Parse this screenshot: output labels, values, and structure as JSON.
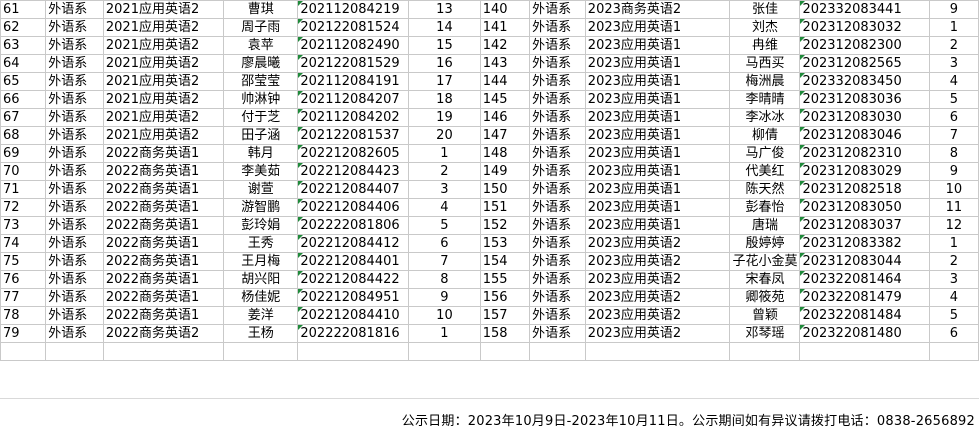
{
  "rows": [
    [
      "61",
      "外语系",
      "2021应用英语2",
      "曹琪",
      "202112084219",
      "13",
      "140",
      "外语系",
      "2023商务英语2",
      "张佳",
      "202332083441",
      "9"
    ],
    [
      "62",
      "外语系",
      "2021应用英语2",
      "周子雨",
      "202122081524",
      "14",
      "141",
      "外语系",
      "2023应用英语1",
      "刘杰",
      "202312083032",
      "1"
    ],
    [
      "63",
      "外语系",
      "2021应用英语2",
      "袁苹",
      "202112082490",
      "15",
      "142",
      "外语系",
      "2023应用英语1",
      "冉维",
      "202312082300",
      "2"
    ],
    [
      "64",
      "外语系",
      "2021应用英语2",
      "廖晨曦",
      "202122081529",
      "16",
      "143",
      "外语系",
      "2023应用英语1",
      "马西买",
      "202312082565",
      "3"
    ],
    [
      "65",
      "外语系",
      "2021应用英语2",
      "邵莹莹",
      "202112084191",
      "17",
      "144",
      "外语系",
      "2023应用英语1",
      "梅洲晨",
      "202332083450",
      "4"
    ],
    [
      "66",
      "外语系",
      "2021应用英语2",
      "帅淋钟",
      "202112084207",
      "18",
      "145",
      "外语系",
      "2023应用英语1",
      "李晴晴",
      "202312083036",
      "5"
    ],
    [
      "67",
      "外语系",
      "2021应用英语2",
      "付于芝",
      "202112084202",
      "19",
      "146",
      "外语系",
      "2023应用英语1",
      "李冰冰",
      "202312083030",
      "6"
    ],
    [
      "68",
      "外语系",
      "2021应用英语2",
      "田子涵",
      "202122081537",
      "20",
      "147",
      "外语系",
      "2023应用英语1",
      "柳倩",
      "202312083046",
      "7"
    ],
    [
      "69",
      "外语系",
      "2022商务英语1",
      "韩月",
      "202212082605",
      "1",
      "148",
      "外语系",
      "2023应用英语1",
      "马广俊",
      "202312082310",
      "8"
    ],
    [
      "70",
      "外语系",
      "2022商务英语1",
      "李美茹",
      "202212084423",
      "2",
      "149",
      "外语系",
      "2023应用英语1",
      "代美红",
      "202312083029",
      "9"
    ],
    [
      "71",
      "外语系",
      "2022商务英语1",
      "谢萱",
      "202212084407",
      "3",
      "150",
      "外语系",
      "2023应用英语1",
      "陈天然",
      "202312082518",
      "10"
    ],
    [
      "72",
      "外语系",
      "2022商务英语1",
      "游智鹏",
      "202212084406",
      "4",
      "151",
      "外语系",
      "2023应用英语1",
      "彭春怡",
      "202312083050",
      "11"
    ],
    [
      "73",
      "外语系",
      "2022商务英语1",
      "彭玲娟",
      "202222081806",
      "5",
      "152",
      "外语系",
      "2023应用英语1",
      "唐瑞",
      "202312083037",
      "12"
    ],
    [
      "74",
      "外语系",
      "2022商务英语1",
      "王秀",
      "202212084412",
      "6",
      "153",
      "外语系",
      "2023应用英语2",
      "殷婷婷",
      "202312083382",
      "1"
    ],
    [
      "75",
      "外语系",
      "2022商务英语1",
      "王月梅",
      "202212084401",
      "7",
      "154",
      "外语系",
      "2023应用英语2",
      "子花小金莫",
      "202312083044",
      "2"
    ],
    [
      "76",
      "外语系",
      "2022商务英语1",
      "胡兴阳",
      "202212084422",
      "8",
      "155",
      "外语系",
      "2023应用英语2",
      "宋春凤",
      "202322081464",
      "3"
    ],
    [
      "77",
      "外语系",
      "2022商务英语1",
      "杨佳妮",
      "202212084951",
      "9",
      "156",
      "外语系",
      "2023应用英语2",
      "卿筱苑",
      "202322081479",
      "4"
    ],
    [
      "78",
      "外语系",
      "2022商务英语1",
      "姜洋",
      "202212084410",
      "10",
      "157",
      "外语系",
      "2023应用英语2",
      "曾颖",
      "202322081484",
      "5"
    ],
    [
      "79",
      "外语系",
      "2022商务英语2",
      "王杨",
      "202222081816",
      "1",
      "158",
      "外语系",
      "2023应用英语2",
      "邓琴瑶",
      "202322081480",
      "6"
    ]
  ],
  "notice": "公示日期：2023年10月9日-2023年10月11日。公示期间如有异议请拨打电话：0838-2656892"
}
